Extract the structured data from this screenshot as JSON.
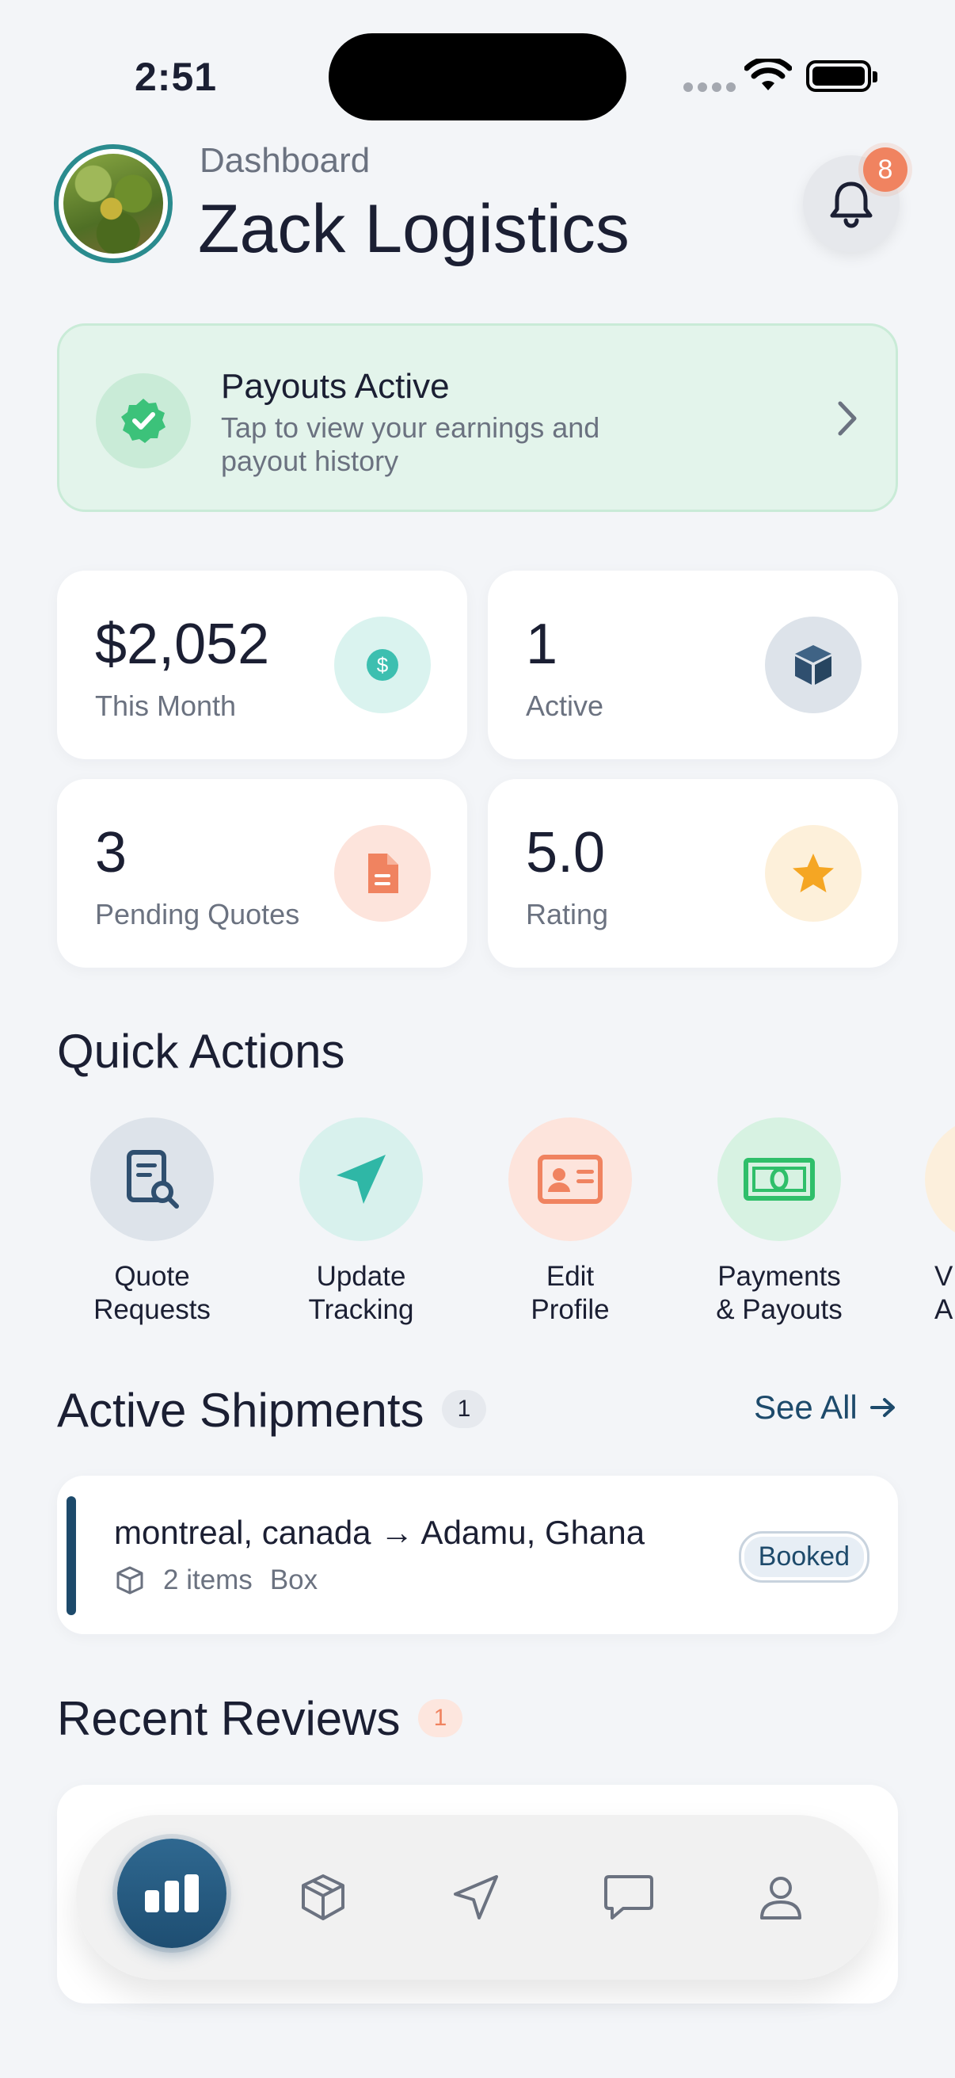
{
  "status_bar": {
    "time": "2:51"
  },
  "header": {
    "subtitle": "Dashboard",
    "title": "Zack Logistics",
    "notification_count": "8"
  },
  "payouts_banner": {
    "title": "Payouts Active",
    "description": "Tap to view your earnings and payout history",
    "icon": "verified-badge-icon",
    "accent": "#3cc27a"
  },
  "stats": [
    {
      "value": "$2,052",
      "label": "This Month",
      "icon": "dollar-icon",
      "color": "#3dbfb0"
    },
    {
      "value": "1",
      "label": "Active",
      "icon": "package-icon",
      "color": "#2f4f6f"
    },
    {
      "value": "3",
      "label": "Pending Quotes",
      "icon": "document-icon",
      "color": "#f08360"
    },
    {
      "value": "5.0",
      "label": "Rating",
      "icon": "star-icon",
      "color": "#f5a623"
    }
  ],
  "quick_actions": {
    "title": "Quick Actions",
    "items": [
      {
        "label": "Quote\nRequests",
        "icon": "quote-search-icon"
      },
      {
        "label": "Update\nTracking",
        "icon": "navigation-arrow-icon"
      },
      {
        "label": "Edit\nProfile",
        "icon": "id-card-icon"
      },
      {
        "label": "Payments\n& Payouts",
        "icon": "banknote-icon"
      },
      {
        "label": "V\nA",
        "icon": "partial-icon"
      }
    ]
  },
  "active_shipments": {
    "title": "Active Shipments",
    "count": "1",
    "see_all": "See All",
    "items": [
      {
        "route": "montreal, canada → Adamu, Ghana",
        "items": "2 items",
        "type": "Box",
        "status": "Booked"
      }
    ]
  },
  "recent_reviews": {
    "title": "Recent Reviews",
    "count": "1"
  },
  "tab_bar": {
    "tabs": [
      "dashboard-icon",
      "package-icon",
      "navigation-icon",
      "chat-icon",
      "profile-icon"
    ],
    "active": "dashboard-icon"
  }
}
